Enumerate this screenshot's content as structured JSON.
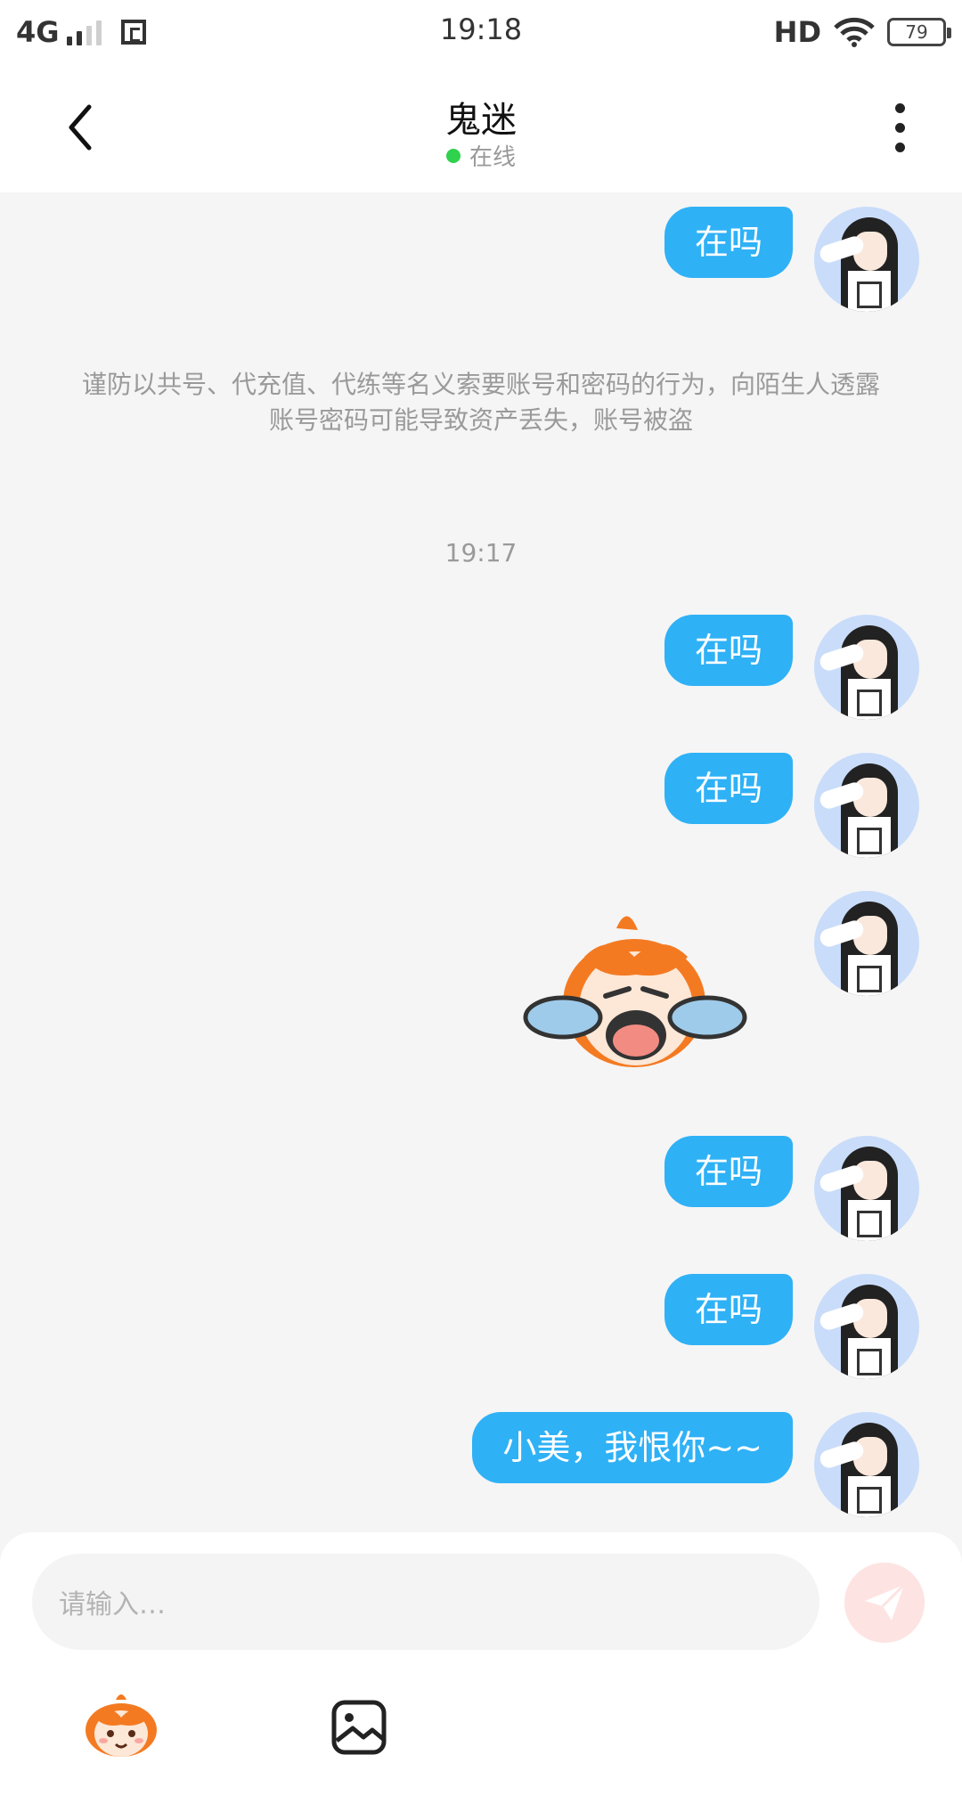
{
  "status_bar": {
    "network": "4G",
    "time": "19:18",
    "hd": "HD",
    "battery": "79"
  },
  "header": {
    "title": "鬼迷",
    "status": "在线",
    "icons": {
      "back": "chevron-left-icon",
      "more": "more-vertical-icon"
    }
  },
  "messages": [
    {
      "type": "text",
      "text": "在吗"
    },
    {
      "type": "text",
      "text": "在吗"
    },
    {
      "type": "text",
      "text": "在吗"
    },
    {
      "type": "sticker",
      "name": "crying-sticker"
    },
    {
      "type": "text",
      "text": "在吗"
    },
    {
      "type": "text",
      "text": "在吗"
    },
    {
      "type": "text",
      "text": "小美，我恨你~~"
    }
  ],
  "notice": "谨防以共号、代充值、代练等名义索要账号和密码的行为，向陌生人透露账号密码可能导致资产丢失，账号被盗",
  "time_divider": "19:17",
  "input": {
    "placeholder": "请输入…"
  },
  "toolbar": {
    "icons": [
      "emoji-icon",
      "image-icon",
      "send-icon"
    ]
  },
  "colors": {
    "bubble": "#2fb1f6",
    "online": "#2fd14d",
    "background": "#f5f5f5",
    "send": "#fde3e1"
  }
}
